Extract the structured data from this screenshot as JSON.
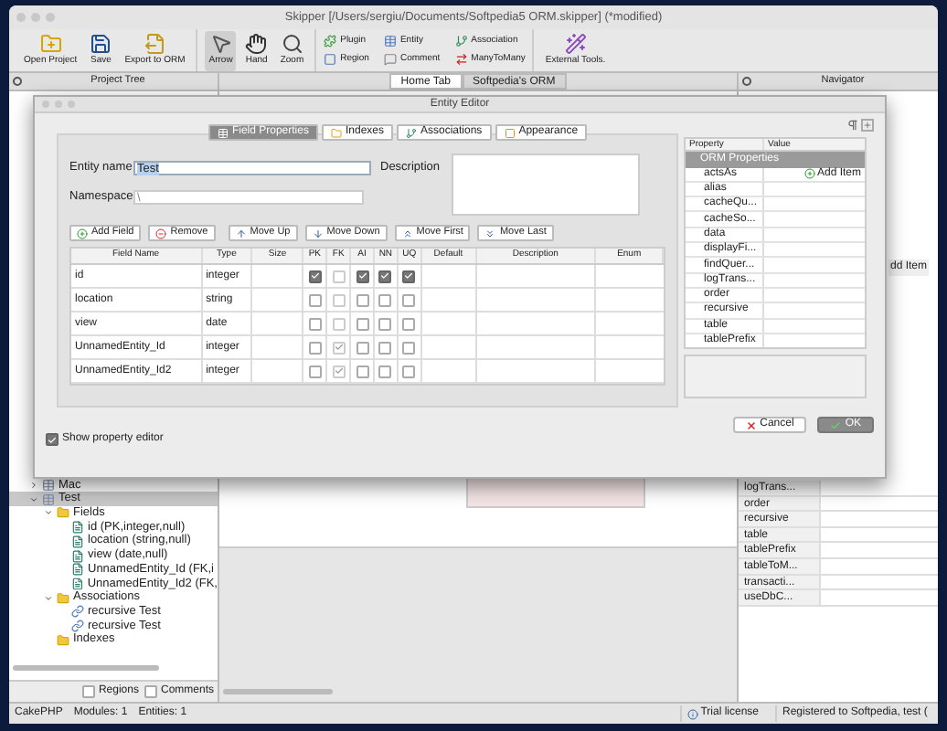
{
  "window": {
    "title": "Skipper [/Users/sergiu/Documents/Softpedia5 ORM.skipper] (*modified)"
  },
  "toolbar": {
    "groups": [
      {
        "kind": "large",
        "items": [
          {
            "label": "Open Project",
            "kind": "open"
          },
          {
            "label": "Save",
            "kind": "save"
          },
          {
            "label": "Export to ORM",
            "kind": "export"
          }
        ]
      },
      {
        "kind": "large",
        "items": [
          {
            "label": "Arrow",
            "kind": "arrow",
            "selected": true
          },
          {
            "label": "Hand",
            "kind": "hand",
            "selected": false
          },
          {
            "label": "Zoom",
            "kind": "zoom",
            "selected": false
          }
        ]
      },
      {
        "kind": "small",
        "items": [
          {
            "label": "Plugin",
            "kind": "plugin"
          },
          {
            "label": "Region",
            "kind": "region"
          },
          {
            "label": "Entity",
            "kind": "entity"
          },
          {
            "label": "Comment",
            "kind": "comment"
          },
          {
            "label": "Association",
            "kind": "association"
          },
          {
            "label": "ManyToMany",
            "kind": "manytomany"
          }
        ]
      },
      {
        "kind": "large",
        "items": [
          {
            "label": "External Tools.",
            "kind": "external"
          }
        ]
      }
    ]
  },
  "project_tree": {
    "title": "Project Tree"
  },
  "document_tabs": [
    {
      "label": "Home Tab",
      "selected": false
    },
    {
      "label": "Softpedia's ORM",
      "selected": true
    }
  ],
  "navigator": {
    "title": "Navigator"
  },
  "tree": [
    {
      "label": "Mac",
      "kind": "entity",
      "expanded": false,
      "selected": false
    },
    {
      "label": "Test",
      "kind": "entity",
      "expanded": true,
      "selected": true,
      "children": [
        {
          "label": "Fields",
          "kind": "folder",
          "expanded": true,
          "selected": false,
          "children": [
            {
              "label": "id (PK,integer,null)",
              "kind": "field",
              "selected": false
            },
            {
              "label": "location (string,null)",
              "kind": "field",
              "selected": false
            },
            {
              "label": "view (date,null)",
              "kind": "field",
              "selected": false
            },
            {
              "label": "UnnamedEntity_Id (FK,i",
              "kind": "field",
              "selected": false
            },
            {
              "label": "UnnamedEntity_Id2 (FK,",
              "kind": "field",
              "selected": false
            }
          ]
        },
        {
          "label": "Associations",
          "kind": "folder",
          "expanded": true,
          "selected": false,
          "children": [
            {
              "label": "recursive Test",
              "kind": "association",
              "selected": false
            },
            {
              "label": "recursive Test",
              "kind": "association",
              "selected": false
            }
          ]
        },
        {
          "label": "Indexes",
          "kind": "folder",
          "selected": false
        }
      ]
    }
  ],
  "tree_filters": [
    {
      "label": "Regions",
      "checked": false
    },
    {
      "label": "Comments",
      "checked": false
    }
  ],
  "background_properties": {
    "add_item": "dd Item",
    "items": [
      "logTrans...",
      "order",
      "recursive",
      "table",
      "tablePrefix",
      "tableToM...",
      "transacti...",
      "useDbC..."
    ]
  },
  "status_bar": {
    "framework": "CakePHP",
    "modules": "Modules: 1",
    "entities": "Entities: 1",
    "license": "Trial license",
    "registered": "Registered to Softpedia, test ("
  },
  "entity_editor": {
    "title": "Entity Editor",
    "tabs": [
      {
        "label": "Field Properties",
        "kind": "fields",
        "selected": true
      },
      {
        "label": "Indexes",
        "kind": "indexes",
        "selected": false
      },
      {
        "label": "Associations",
        "kind": "associations",
        "selected": false
      },
      {
        "label": "Appearance",
        "kind": "appearance",
        "selected": false
      }
    ],
    "entity_name_label": "Entity name",
    "entity_name": "Test",
    "description_label": "Description",
    "namespace_label": "Namespace",
    "namespace": "\\",
    "buttons": [
      {
        "label": "Add Field",
        "kind": "add"
      },
      {
        "label": "Remove",
        "kind": "remove"
      },
      {
        "label": "Move Up",
        "kind": "up"
      },
      {
        "label": "Move Down",
        "kind": "down"
      },
      {
        "label": "Move First",
        "kind": "first"
      },
      {
        "label": "Move Last",
        "kind": "last"
      }
    ],
    "columns": [
      "Field Name",
      "Type",
      "Size",
      "PK",
      "FK",
      "AI",
      "NN",
      "UQ",
      "Default",
      "Description",
      "Enum"
    ],
    "rows": [
      {
        "name": "id",
        "type": "integer",
        "pk": true,
        "fk": false,
        "ai": true,
        "nn": true,
        "uq": true
      },
      {
        "name": "location",
        "type": "string",
        "pk": false,
        "fk": false,
        "ai": false,
        "nn": false,
        "uq": false
      },
      {
        "name": "view",
        "type": "date",
        "pk": false,
        "fk": false,
        "ai": false,
        "nn": false,
        "uq": false
      },
      {
        "name": "UnnamedEntity_Id",
        "type": "integer",
        "pk": false,
        "fk": true,
        "ai": false,
        "nn": false,
        "uq": false
      },
      {
        "name": "UnnamedEntity_Id2",
        "type": "integer",
        "pk": false,
        "fk": true,
        "ai": false,
        "nn": false,
        "uq": false
      }
    ],
    "show_property_editor": {
      "label": "Show property editor",
      "checked": true
    },
    "property_editor": {
      "columns": [
        "Property",
        "Value"
      ],
      "group": "ORM Properties",
      "items": [
        {
          "name": "actsAs",
          "value": "Add Item"
        },
        {
          "name": "alias"
        },
        {
          "name": "cacheQu..."
        },
        {
          "name": "cacheSo..."
        },
        {
          "name": "data"
        },
        {
          "name": "displayFi..."
        },
        {
          "name": "findQuer..."
        },
        {
          "name": "logTrans..."
        },
        {
          "name": "order"
        },
        {
          "name": "recursive"
        },
        {
          "name": "table"
        },
        {
          "name": "tablePrefix"
        }
      ]
    },
    "cancel": "Cancel",
    "ok": "OK"
  }
}
